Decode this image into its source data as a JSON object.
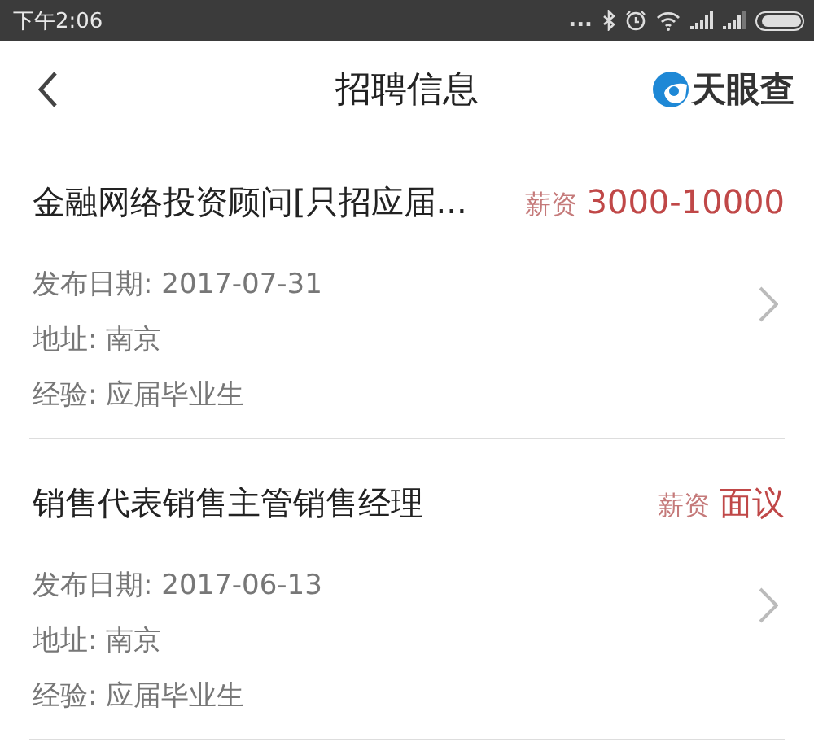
{
  "status_bar": {
    "time": "下午2:06",
    "dots": "..."
  },
  "nav": {
    "title": "招聘信息",
    "logo_text": "天眼查"
  },
  "jobs": [
    {
      "title": "金融网络投资顾问[只招应届...",
      "salary_label": "薪资",
      "salary": "3000-10000",
      "details": [
        "发布日期: 2017-07-31",
        "地址: 南京",
        "经验: 应届毕业生"
      ]
    },
    {
      "title": "销售代表销售主管销售经理",
      "salary_label": "薪资",
      "salary": "面议",
      "details": [
        "发布日期: 2017-06-13",
        "地址: 南京",
        "经验: 应届毕业生"
      ]
    }
  ]
}
